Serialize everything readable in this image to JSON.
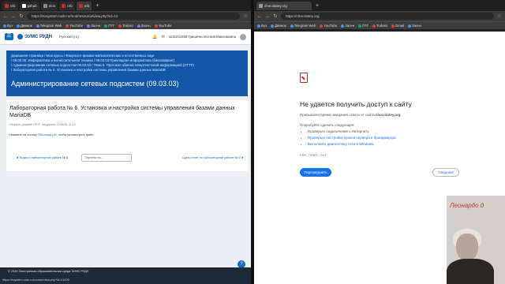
{
  "left_browser": {
    "tabs": [
      {
        "label": "reb"
      },
      {
        "label": "github"
      },
      {
        "label": "elon"
      },
      {
        "label": "reb"
      },
      {
        "label": "reb"
      }
    ],
    "url": "https://eosystem.rudn.ru/mod/resource/view.php?id=12",
    "bookmarks": [
      "Вуз",
      "Движок",
      "Telegram Web",
      "YouTube",
      "Заочн",
      "ГПТ",
      "Todoist",
      "Заочн",
      "YouTube",
      "TO",
      "Звез"
    ]
  },
  "moodle": {
    "logo": "ЭУМС РУДН",
    "lang": "Русский (ru)",
    "user": "1132231938 Гришечко Ксения Максимовна",
    "breadcrumbs": [
      "Домашняя страница / Мои курсы / Факультет физико-математических и естественных наук",
      "/ 09.00.00. Информатика и вычислительная техника / 09.03.03 Прикладная информатика (бакалавриат)",
      "/ Администрирование сетевых подсистем 09.03.03 / Тема 6. Протокол обмена гипертекстовой информацией (HTTP)",
      "/ Лабораторная работа № 6. Установка и настройка системы управления базами данных MariaDB"
    ],
    "page_title": "Администрирование сетевых подсистем (09.03.03)",
    "lab_title": "Лабораторная работа № 6. Установка и настройка системы управления базами данных MariaDB",
    "meta": "Открыто: документ PDF, Загружено: 20/06/24, 11:13",
    "desc_prefix": "Нажмите на ссылку ",
    "desc_link": "006-mysql.pdf",
    "desc_suffix": ", чтобы просмотреть файл.",
    "prev_link": "◄ Видео к лабораторной работе № 6",
    "jump_placeholder": "Перейти на...",
    "next_link": "Сдать отчет по лабораторной работе № 6 ►",
    "footer": "© 2024 Электронная образовательная среда ЭУМС РУДН",
    "status_url": "https://esystem.rudn.ru/course/view.php?id=21009"
  },
  "right_browser": {
    "tab": "chocolatey.org",
    "url": "https://chocolatey.org",
    "bookmarks": [
      "Вуз",
      "Движок",
      "Telegram Web",
      "YouTube",
      "Заочн",
      "ГПТ",
      "Todoist",
      "Gmail",
      "Заочн",
      "Тест",
      "Звез"
    ],
    "error_title": "Не удается получить доступ к сайту",
    "error_sub_prefix": "Превышено время ожидания ответа от сайта ",
    "error_host": "chocolatey.org",
    "try_label": "Попробуйте сделать следующее:",
    "suggestions": [
      "Проверьте подключение к Интернету.",
      "Проверьте настройки прокси-сервера и брандмауэра.",
      "Выполните диагностику сети в Windows."
    ],
    "error_code": "ERR_TIMED_OUT",
    "reload_label": "Перезагрузить",
    "details_label": "Сведения"
  },
  "webcam": {
    "sign_text": "Леонардо д"
  }
}
